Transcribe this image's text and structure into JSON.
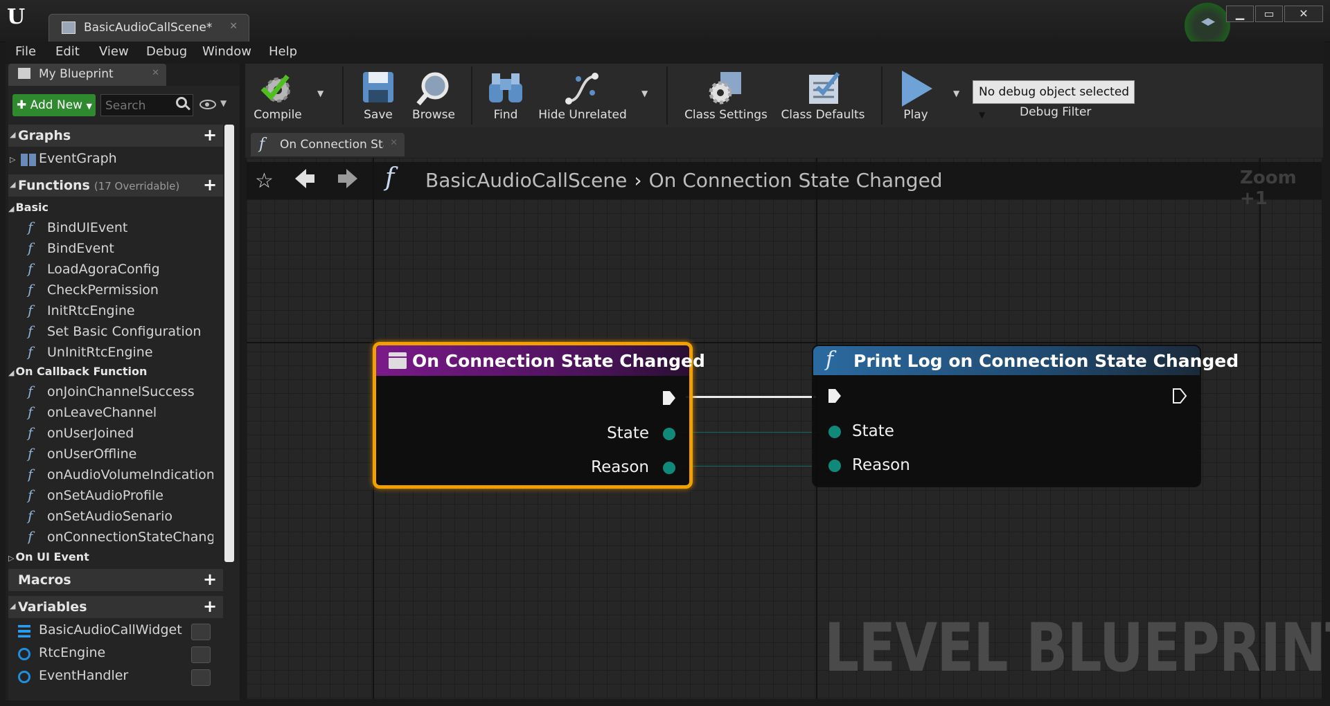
{
  "window": {
    "doc_tab": "BasicAudioCallScene*",
    "buttons": {
      "minimize": "▁",
      "maximize": "▭",
      "close": "✕"
    }
  },
  "menu": [
    "File",
    "Edit",
    "View",
    "Debug",
    "Window",
    "Help"
  ],
  "panel": {
    "tab": "My Blueprint",
    "add_new": "Add New",
    "search_placeholder": "Search",
    "graphs": {
      "label": "Graphs",
      "items": [
        "EventGraph"
      ]
    },
    "functions": {
      "label": "Functions",
      "overridable": "(17 Overridable)",
      "categories": [
        {
          "name": "Basic",
          "items": [
            "BindUIEvent",
            "BindEvent",
            "LoadAgoraConfig",
            "CheckPermission",
            "InitRtcEngine",
            "Set Basic Configuration",
            "UnInitRtcEngine"
          ]
        },
        {
          "name": "On Callback Function",
          "items": [
            "onJoinChannelSuccess",
            "onLeaveChannel",
            "onUserJoined",
            "onUserOffline",
            "onAudioVolumeIndicationC",
            "onSetAudioProfile",
            "onSetAudioSenario",
            "onConnectionStateChange"
          ]
        },
        {
          "name": "On UI Event",
          "items": []
        }
      ]
    },
    "macros": {
      "label": "Macros"
    },
    "variables": {
      "label": "Variables",
      "items": [
        "BasicAudioCallWidget",
        "RtcEngine",
        "EventHandler"
      ]
    }
  },
  "toolbar": {
    "compile": "Compile",
    "save": "Save",
    "browse": "Browse",
    "find": "Find",
    "hide_unrelated": "Hide Unrelated",
    "class_settings": "Class Settings",
    "class_defaults": "Class Defaults",
    "play": "Play",
    "debug_select": "No debug object selected",
    "debug_filter": "Debug Filter"
  },
  "graph": {
    "tab": "On Connection Stat",
    "breadcrumb": [
      "BasicAudioCallScene",
      "On Connection State Changed"
    ],
    "zoom": "Zoom +1",
    "watermark": "LEVEL BLUEPRINT",
    "nodes": {
      "event": {
        "title": "On Connection State Changed",
        "pins": [
          "State",
          "Reason"
        ]
      },
      "print": {
        "title": "Print Log on Connection State Changed",
        "pins": [
          "State",
          "Reason"
        ]
      }
    }
  },
  "colors": {
    "event_header": "#7a1a8a",
    "function_header": "#2b6aa0",
    "selection": "#f0a000",
    "data_pin": "#0f8a7a",
    "add_new": "#2f8a2f"
  }
}
